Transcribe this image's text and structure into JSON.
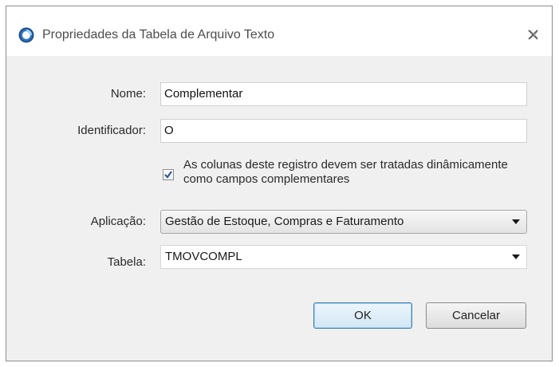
{
  "dialog": {
    "title": "Propriedades da Tabela de Arquivo Texto",
    "close_icon": "close-icon"
  },
  "form": {
    "nome_label": "Nome:",
    "nome_value": "Complementar",
    "identificador_label": "Identificador:",
    "identificador_value": "O",
    "checkbox_checked": true,
    "checkbox_text": "As colunas deste registro devem ser tratadas dinâmicamente como campos complementares",
    "aplicacao_label": "Aplicação:",
    "aplicacao_value": "Gestão de Estoque, Compras e Faturamento",
    "tabela_label": "Tabela:",
    "tabela_value": "TMOVCOMPL"
  },
  "buttons": {
    "ok_label": "OK",
    "cancel_label": "Cancelar"
  },
  "colors": {
    "dialog_bg": "#f0f0f0",
    "title_bg": "#ffffff",
    "ok_border": "#3c7fb1"
  }
}
